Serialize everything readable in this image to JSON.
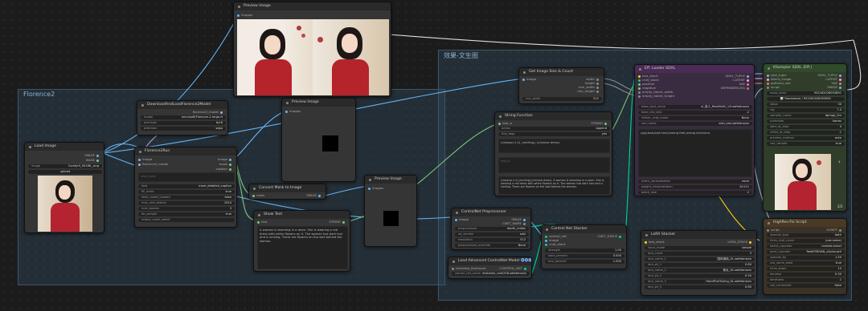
{
  "groups": {
    "florence": "Florence2",
    "wenshengtu": "效果-文生图"
  },
  "preview_top": {
    "title": "Preview Image",
    "in": "images"
  },
  "dl_node": {
    "title": "DownloadAndLoadFlorence2Model",
    "out": "florence2_model",
    "rows": [
      {
        "k": "model",
        "v": "microsoft/Florence-2-large-ft"
      },
      {
        "k": "precision",
        "v": "fp16"
      },
      {
        "k": "attention",
        "v": "sdpa"
      }
    ]
  },
  "load_image": {
    "title": "Load Image",
    "out1": "IMAGE",
    "out2": "MASK",
    "image_k": "image",
    "image_v": "ComfyUI_00186_.png",
    "upload": "upload"
  },
  "florence_run": {
    "title": "Florence2Run",
    "in1": "image",
    "in2": "florence2_model",
    "o1": "image",
    "o2": "mask",
    "o3": "caption",
    "text_input": "text_input",
    "rows": [
      {
        "k": "task",
        "v": "more_detailed_caption"
      },
      {
        "k": "fill_mask",
        "v": "true"
      },
      {
        "k": "keep_model_loaded",
        "v": "false"
      },
      {
        "k": "max_new_tokens",
        "v": "1024"
      },
      {
        "k": "num_beams",
        "v": "3"
      },
      {
        "k": "do_sample",
        "v": "true"
      },
      {
        "k": "output_mask_select",
        "v": ""
      }
    ]
  },
  "preview_mid": {
    "title": "Preview Image",
    "in": "images"
  },
  "convert_mask": {
    "title": "Convert Mask to Image",
    "in": "mask",
    "out": "IMAGE"
  },
  "show_text": {
    "title": "Show Text",
    "in": "text",
    "out": "STRING",
    "text": "A woman is standing in a room. She is wearing a red dress with white flowers on it. The woman has dark hair and is smiling. There are flowers on the wall behind the woman."
  },
  "preview_lower": {
    "title": "Preview Image",
    "in": "images"
  },
  "get_size": {
    "title": "Get Image Size & Count",
    "in": "image",
    "outs": [
      "width",
      "height",
      "min_width",
      "min_height"
    ],
    "w_k": "min_width",
    "w_v": "512"
  },
  "string_fn": {
    "title": "String Function",
    "in": "text_a",
    "out": "STRING",
    "rows": [
      {
        "k": "action",
        "v": "append"
      },
      {
        "k": "tidy_tags",
        "v": "yes"
      }
    ],
    "text_a_val": "(closeup:1.2), (smiling), (chinese dress)",
    "text_c_val": "",
    "text_b": "text_b",
    "result": "(closeup:1.2),(smiling),(chinese dress), A woman is standing in a room. She is wearing a red dress with white flowers on it. The woman has dark hair and is smiling. There are flowers on the wall behind the woman."
  },
  "cn_pre": {
    "title": "ControlNet Preprocessor",
    "in": "image",
    "outs": [
      "IMAGE",
      "CNET_NAME"
    ],
    "rows": [
      {
        "k": "preprocessor",
        "v": "depth_midas"
      },
      {
        "k": "sd_version",
        "v": "sdxl"
      },
      {
        "k": "resolution",
        "v": "512"
      },
      {
        "k": "preprocessor_override",
        "v": "None"
      }
    ]
  },
  "cn_stacker": {
    "title": "Control Net Stacker",
    "ins": [
      "control_net",
      "image",
      "cnet_stack"
    ],
    "out": "CNET_STACK",
    "rows": [
      {
        "k": "strength",
        "v": "1.00"
      },
      {
        "k": "start_percent",
        "v": "0.000"
      },
      {
        "k": "end_percent",
        "v": "1.000"
      }
    ]
  },
  "adv_cn": {
    "title": "Load Advanced ControlNet Model",
    "badge": "🅐🅓🅒",
    "in": "timestep_keyframe",
    "out": "CONTROL_NET",
    "row_k": "control_net_name",
    "row_v": "mistoline_rank256.safetensors"
  },
  "eff_loader": {
    "title": "Eff. Loader SDXL",
    "ins": [
      "lora_stack",
      "cnet_stack",
      "positive",
      "negative",
      "empty_latent_width",
      "empty_latent_height"
    ],
    "outs": [
      "SDXL_TUPLE",
      "LATENT",
      "VAE",
      "DEPENDENCIES"
    ],
    "rows": [
      {
        "k": "base_ckpt_name",
        "v": "xl_真人_RealVisXL_V4.safetensors"
      },
      {
        "k": "base_clip_skip",
        "v": "-2"
      },
      {
        "k": "refiner_ckpt_name",
        "v": "None"
      },
      {
        "k": "vae_name",
        "v": "sdxl_vae.safetensors"
      }
    ],
    "positive": "",
    "negative": "ugly,bad,bad hand,wrong feet,wrong structure,",
    "rows2": [
      {
        "k": "token_normalization",
        "v": "none"
      },
      {
        "k": "weight_interpretation",
        "v": "A1111"
      },
      {
        "k": "batch_size",
        "v": "2"
      }
    ]
  },
  "ksampler": {
    "title": "KSampler SDXL (Eff.)",
    "ins": [
      "sdxl_tuple",
      "latent_image",
      "optional_vae",
      "script"
    ],
    "outs": [
      "SDXL_TUPLE",
      "LATENT",
      "VAE",
      "IMAGE"
    ],
    "seed_k": "noise_seed",
    "seed_v": "952262028953891",
    "rand_label": "🎲 Randomize / 952262028953891",
    "rows": [
      {
        "k": "steps",
        "v": "30"
      },
      {
        "k": "cfg",
        "v": "7.0"
      },
      {
        "k": "sampler_name",
        "v": "dpmpp_2m"
      },
      {
        "k": "scheduler",
        "v": "karras"
      },
      {
        "k": "start_at_step",
        "v": "0"
      },
      {
        "k": "refine_at_step",
        "v": "-1"
      },
      {
        "k": "preview_method",
        "v": "auto"
      },
      {
        "k": "vae_decode",
        "v": "true"
      }
    ],
    "page": "2/2",
    "arrow": "‹"
  },
  "lora": {
    "title": "LoRA Stacker",
    "in": "lora_stack",
    "out": "LORA_STACK",
    "rows": [
      {
        "k": "input_mode",
        "v": "simple"
      },
      {
        "k": "lora_count",
        "v": "3"
      },
      {
        "k": "lora_name_1",
        "v": "国风旗袍_XL.safetensors"
      },
      {
        "k": "lora_wt_1",
        "v": "0.80"
      },
      {
        "k": "lora_name_2",
        "v": "美女_XL.safetensors"
      },
      {
        "k": "lora_wt_2",
        "v": "0.50"
      },
      {
        "k": "lora_name_3",
        "v": "HandFineTuning_XL.safetensors"
      },
      {
        "k": "lora_wt_3",
        "v": "0.60"
      }
    ]
  },
  "hires": {
    "title": "HighRes-Fix Script",
    "in": "script",
    "out": "SCRIPT",
    "rows": [
      {
        "k": "upscale_type",
        "v": "both"
      },
      {
        "k": "hires_ckpt_name",
        "v": "(use same)"
      },
      {
        "k": "latent_upscaler",
        "v": "nearest-exact"
      },
      {
        "k": "pixel_upscaler",
        "v": "RealESRGAN_x4plus.pth"
      },
      {
        "k": "upscale_by",
        "v": "1.50"
      },
      {
        "k": "use_same_seed",
        "v": "true"
      },
      {
        "k": "hires_steps",
        "v": "10"
      },
      {
        "k": "denoise",
        "v": "0.30"
      },
      {
        "k": "iterations",
        "v": "1"
      },
      {
        "k": "use_controlnet",
        "v": "false"
      }
    ]
  },
  "colors": {
    "model": "#b39ddb",
    "image": "#64b5f6",
    "mask": "#81c784",
    "string": "#7bc67b",
    "latent": "#ff9cf9",
    "vae": "#ff6e6e",
    "cnet": "#00d78d",
    "lora": "#ffd600"
  }
}
